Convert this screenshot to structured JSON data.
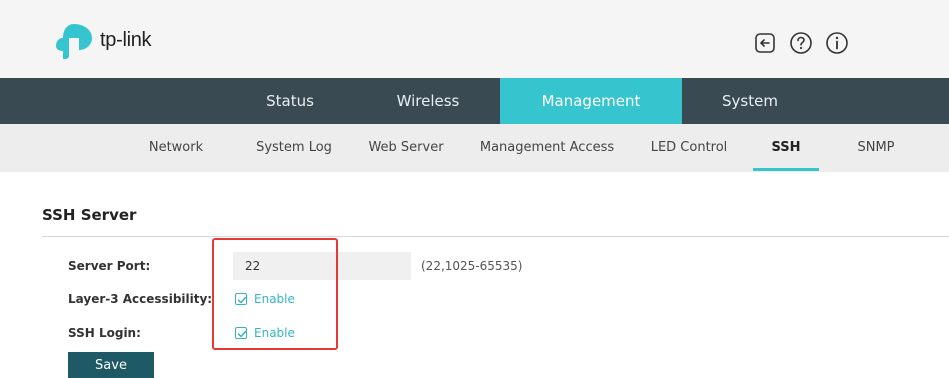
{
  "header": {
    "brand": "tp-link",
    "icons": [
      "logout-icon",
      "help-icon",
      "info-icon"
    ]
  },
  "nav": {
    "items": [
      {
        "label": "Status"
      },
      {
        "label": "Wireless"
      },
      {
        "label": "Management",
        "active": true
      },
      {
        "label": "System"
      }
    ]
  },
  "subnav": {
    "items": [
      {
        "label": "Network"
      },
      {
        "label": "System Log"
      },
      {
        "label": "Web Server"
      },
      {
        "label": "Management Access"
      },
      {
        "label": "LED Control"
      },
      {
        "label": "SSH",
        "active": true
      },
      {
        "label": "SNMP"
      }
    ]
  },
  "ssh": {
    "title": "SSH Server",
    "server_port_label": "Server Port:",
    "server_port_value": "22",
    "server_port_range": "(22,1025-65535)",
    "layer3_label": "Layer-3 Accessibility:",
    "layer3_checkbox_label": "Enable",
    "ssh_login_label": "SSH Login:",
    "ssh_login_checkbox_label": "Enable",
    "save_label": "Save"
  },
  "colors": {
    "nav_bg": "#3a4a52",
    "accent": "#36c4cf",
    "save_button": "#1e5a66",
    "highlight": "#e53935"
  }
}
